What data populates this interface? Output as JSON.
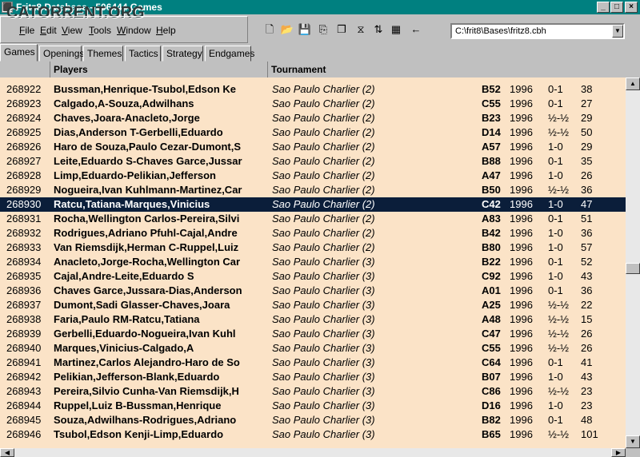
{
  "window": {
    "title": "Fritz8 Database - 506444 Games",
    "watermark": "CATORRENT.ORG",
    "sys_icon": "⬛",
    "controls": [
      "_",
      "□",
      "×"
    ]
  },
  "menu": {
    "items": [
      "File",
      "Edit",
      "View",
      "Tools",
      "Window",
      "Help"
    ],
    "accel": [
      "F",
      "E",
      "V",
      "T",
      "W",
      "H"
    ]
  },
  "toolbar": {
    "icons": [
      "new-icon",
      "open-icon",
      "save-icon",
      "copy-icon",
      "clone-icon",
      "filter-icon",
      "sort-icon",
      "table-icon",
      "back-arrow-icon"
    ],
    "glyphs": [
      "🗋",
      "📂",
      "💾",
      "⎘",
      "❐",
      "⧖",
      "⇅",
      "▦",
      "←"
    ]
  },
  "path": {
    "value": "C:\\frit8\\Bases\\fritz8.cbh",
    "drop_glyph": "▼"
  },
  "tabs": [
    "Games",
    "Openings",
    "Themes",
    "Tactics",
    "Strategy",
    "Endgames"
  ],
  "active_tab": "Games",
  "columns": {
    "players": "Players",
    "tournament": "Tournament"
  },
  "games": [
    {
      "no": "268922",
      "players": "Bussman,Henrique-Tsubol,Edson Ke",
      "tournament": "Sao Paulo Charlier (2)",
      "eco": "B52",
      "year": "1996",
      "result": "0-1",
      "moves": "38"
    },
    {
      "no": "268923",
      "players": "Calgado,A-Souza,Adwilhans",
      "tournament": "Sao Paulo Charlier (2)",
      "eco": "C55",
      "year": "1996",
      "result": "0-1",
      "moves": "27"
    },
    {
      "no": "268924",
      "players": "Chaves,Joara-Anacleto,Jorge",
      "tournament": "Sao Paulo Charlier (2)",
      "eco": "B23",
      "year": "1996",
      "result": "½-½",
      "moves": "29"
    },
    {
      "no": "268925",
      "players": "Dias,Anderson T-Gerbelli,Eduardo",
      "tournament": "Sao Paulo Charlier (2)",
      "eco": "D14",
      "year": "1996",
      "result": "½-½",
      "moves": "50"
    },
    {
      "no": "268926",
      "players": "Haro de Souza,Paulo Cezar-Dumont,S",
      "tournament": "Sao Paulo Charlier (2)",
      "eco": "A57",
      "year": "1996",
      "result": "1-0",
      "moves": "29"
    },
    {
      "no": "268927",
      "players": "Leite,Eduardo S-Chaves Garce,Jussar",
      "tournament": "Sao Paulo Charlier (2)",
      "eco": "B88",
      "year": "1996",
      "result": "0-1",
      "moves": "35"
    },
    {
      "no": "268928",
      "players": "Limp,Eduardo-Pelikian,Jefferson",
      "tournament": "Sao Paulo Charlier (2)",
      "eco": "A47",
      "year": "1996",
      "result": "1-0",
      "moves": "26"
    },
    {
      "no": "268929",
      "players": "Nogueira,Ivan Kuhlmann-Martinez,Car",
      "tournament": "Sao Paulo Charlier (2)",
      "eco": "B50",
      "year": "1996",
      "result": "½-½",
      "moves": "36"
    },
    {
      "no": "268930",
      "players": "Ratcu,Tatiana-Marques,Vinicius",
      "tournament": "Sao Paulo Charlier (2)",
      "eco": "C42",
      "year": "1996",
      "result": "1-0",
      "moves": "47",
      "selected": true
    },
    {
      "no": "268931",
      "players": "Rocha,Wellington Carlos-Pereira,Silvi",
      "tournament": "Sao Paulo Charlier (2)",
      "eco": "A83",
      "year": "1996",
      "result": "0-1",
      "moves": "51"
    },
    {
      "no": "268932",
      "players": "Rodrigues,Adriano Pfuhl-Cajal,Andre",
      "tournament": "Sao Paulo Charlier (2)",
      "eco": "B42",
      "year": "1996",
      "result": "1-0",
      "moves": "36"
    },
    {
      "no": "268933",
      "players": "Van Riemsdijk,Herman C-Ruppel,Luiz",
      "tournament": "Sao Paulo Charlier (2)",
      "eco": "B80",
      "year": "1996",
      "result": "1-0",
      "moves": "57"
    },
    {
      "no": "268934",
      "players": "Anacleto,Jorge-Rocha,Wellington Car",
      "tournament": "Sao Paulo Charlier (3)",
      "eco": "B22",
      "year": "1996",
      "result": "0-1",
      "moves": "52"
    },
    {
      "no": "268935",
      "players": "Cajal,Andre-Leite,Eduardo S",
      "tournament": "Sao Paulo Charlier (3)",
      "eco": "C92",
      "year": "1996",
      "result": "1-0",
      "moves": "43"
    },
    {
      "no": "268936",
      "players": "Chaves Garce,Jussara-Dias,Anderson",
      "tournament": "Sao Paulo Charlier (3)",
      "eco": "A01",
      "year": "1996",
      "result": "0-1",
      "moves": "36"
    },
    {
      "no": "268937",
      "players": "Dumont,Sadi Glasser-Chaves,Joara",
      "tournament": "Sao Paulo Charlier (3)",
      "eco": "A25",
      "year": "1996",
      "result": "½-½",
      "moves": "22"
    },
    {
      "no": "268938",
      "players": "Faria,Paulo RM-Ratcu,Tatiana",
      "tournament": "Sao Paulo Charlier (3)",
      "eco": "A48",
      "year": "1996",
      "result": "½-½",
      "moves": "15"
    },
    {
      "no": "268939",
      "players": "Gerbelli,Eduardo-Nogueira,Ivan Kuhl",
      "tournament": "Sao Paulo Charlier (3)",
      "eco": "C47",
      "year": "1996",
      "result": "½-½",
      "moves": "26"
    },
    {
      "no": "268940",
      "players": "Marques,Vinicius-Calgado,A",
      "tournament": "Sao Paulo Charlier (3)",
      "eco": "C55",
      "year": "1996",
      "result": "½-½",
      "moves": "26"
    },
    {
      "no": "268941",
      "players": "Martinez,Carlos Alejandro-Haro de So",
      "tournament": "Sao Paulo Charlier (3)",
      "eco": "C64",
      "year": "1996",
      "result": "0-1",
      "moves": "41"
    },
    {
      "no": "268942",
      "players": "Pelikian,Jefferson-Blank,Eduardo",
      "tournament": "Sao Paulo Charlier (3)",
      "eco": "B07",
      "year": "1996",
      "result": "1-0",
      "moves": "43"
    },
    {
      "no": "268943",
      "players": "Pereira,Silvio Cunha-Van Riemsdijk,H",
      "tournament": "Sao Paulo Charlier (3)",
      "eco": "C86",
      "year": "1996",
      "result": "½-½",
      "moves": "23"
    },
    {
      "no": "268944",
      "players": "Ruppel,Luiz B-Bussman,Henrique",
      "tournament": "Sao Paulo Charlier (3)",
      "eco": "D16",
      "year": "1996",
      "result": "1-0",
      "moves": "23"
    },
    {
      "no": "268945",
      "players": "Souza,Adwilhans-Rodrigues,Adriano",
      "tournament": "Sao Paulo Charlier (3)",
      "eco": "B82",
      "year": "1996",
      "result": "0-1",
      "moves": "48"
    },
    {
      "no": "268946",
      "players": "Tsubol,Edson Kenji-Limp,Eduardo",
      "tournament": "Sao Paulo Charlier (3)",
      "eco": "B65",
      "year": "1996",
      "result": "½-½",
      "moves": "101"
    }
  ],
  "scroll": {
    "up": "▲",
    "down": "▼",
    "left": "◀",
    "right": "▶"
  },
  "colors": {
    "titlebar": "#008080",
    "grid_bg": "#fbe3c7",
    "selected_row": "#0b1e3a"
  }
}
